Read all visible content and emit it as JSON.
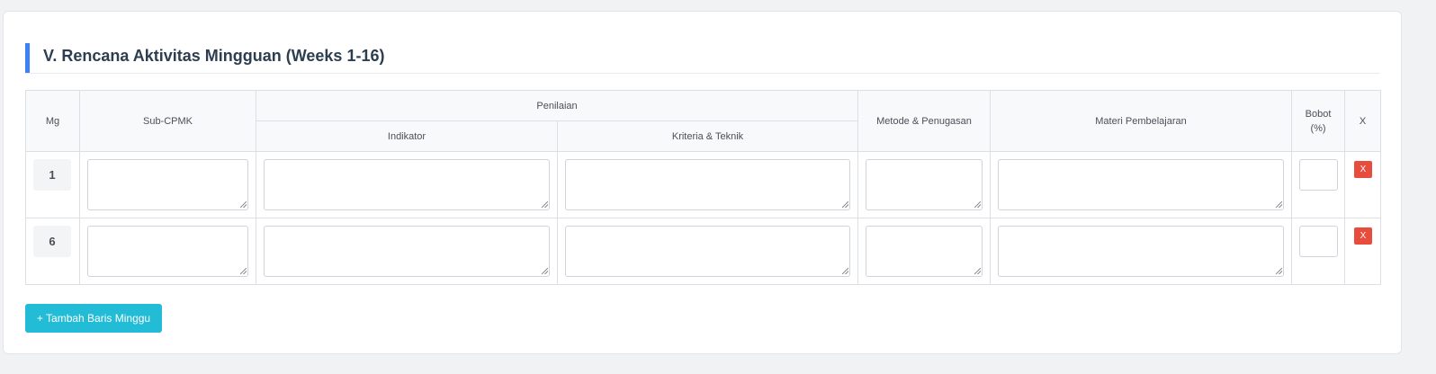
{
  "section": {
    "title": "V. Rencana Aktivitas Mingguan (Weeks 1-16)",
    "accent_color": "#3b82f6"
  },
  "table": {
    "headers": {
      "mg": "Mg",
      "sub_cpmk": "Sub-CPMK",
      "penilaian": "Penilaian",
      "indikator": "Indikator",
      "kriteria": "Kriteria & Teknik",
      "metode": "Metode & Penugasan",
      "materi": "Materi Pembelajaran",
      "bobot_line1": "Bobot",
      "bobot_line2": "(%)",
      "remove": "X"
    },
    "rows": [
      {
        "week": "1",
        "sub_cpmk": "",
        "indikator": "",
        "kriteria": "",
        "metode": "",
        "materi": "",
        "bobot": "",
        "remove_label": "X"
      },
      {
        "week": "6",
        "sub_cpmk": "",
        "indikator": "",
        "kriteria": "",
        "metode": "",
        "materi": "",
        "bobot": "",
        "remove_label": "X"
      }
    ]
  },
  "buttons": {
    "add_week_label": "+ Tambah Baris Minggu",
    "add_color": "#22bcd6",
    "remove_color": "#e74c3c"
  },
  "icons": {
    "resize_handle": "resize-grip-icon"
  }
}
